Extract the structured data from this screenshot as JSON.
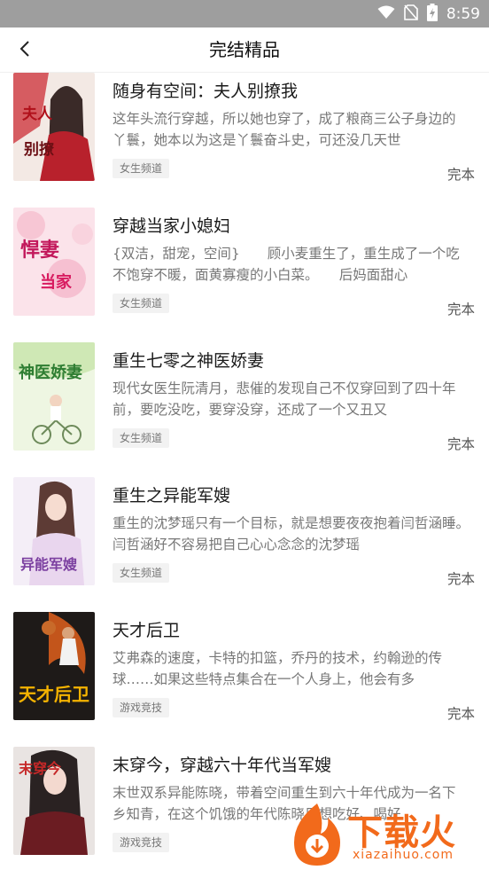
{
  "status_bar": {
    "time": "8:59",
    "icons": [
      "wifi-icon",
      "no-sim-icon",
      "battery-charging-icon"
    ]
  },
  "header": {
    "title": "完结精品",
    "back_icon": "chevron-left-icon"
  },
  "books": [
    {
      "title": "随身有空间：夫人别撩我",
      "desc": "这年头流行穿越，所以她也穿了，成了粮商三公子身边的丫鬟，她本以为这是丫鬟奋斗史，可还没几天世",
      "tag": "女生频道",
      "status": "完本",
      "cover_title": "夫人别撩我"
    },
    {
      "title": "穿越当家小媳妇",
      "desc": "{双洁，甜宠，空间}　　顾小麦重生了，重生成了一个吃不饱穿不暖，面黄寡瘦的小白菜。　　后妈面甜心",
      "tag": "女生频道",
      "status": "完本",
      "cover_title": "悍妻当家"
    },
    {
      "title": "重生七零之神医娇妻",
      "desc": "现代女医生阮清月，悲催的发现自己不仅穿回到了四十年前，要吃没吃，要穿没穿，还成了一个又丑又",
      "tag": "女生频道",
      "status": "完本",
      "cover_title": "神医娇妻"
    },
    {
      "title": "重生之异能军嫂",
      "desc": "重生的沈梦瑶只有一个目标，就是想要夜夜抱着闫哲涵睡。　　闫哲涵好不容易把自己心心念念的沈梦瑶",
      "tag": "女生频道",
      "status": "完本",
      "cover_title": "异能军嫂"
    },
    {
      "title": "天才后卫",
      "desc": "艾弗森的速度，卡特的扣篮，乔丹的技术，约翰逊的传球……如果这些特点集合在一个人身上，他会有多",
      "tag": "游戏竞技",
      "status": "完本",
      "cover_title": "天才后卫"
    },
    {
      "title": "末穿今，穿越六十年代当军嫂",
      "desc": "末世双系异能陈晓，带着空间重生到六十年代成为一名下乡知青，在这个饥饿的年代陈晓只想吃好、喝好",
      "tag": "游戏竞技",
      "status": "",
      "cover_title": "末穿今"
    }
  ],
  "watermark": {
    "text": "下载火",
    "url": "xiazaihuo.com"
  },
  "colors": {
    "status_bar": "#9e9e9e",
    "watermark": "#f26a1b",
    "tag_bg": "#f2f2f2"
  }
}
